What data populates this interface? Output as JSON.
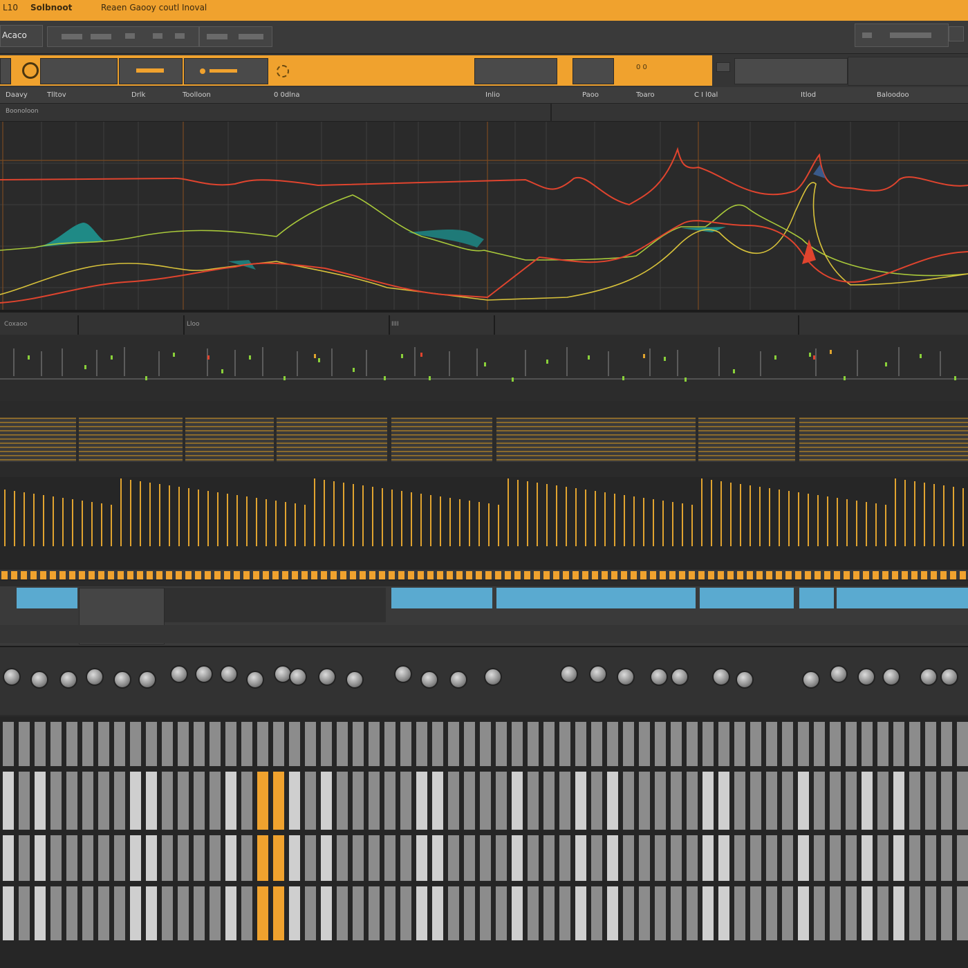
{
  "titlebar": {
    "left_label": "L10",
    "app_name": "Solbnoot",
    "doc_title": "Reaen Gaooy coutl Inoval"
  },
  "toolbar": {
    "brand": "Acaco"
  },
  "transport": {
    "readout": "0  0"
  },
  "header": {
    "columns": [
      "Daavy",
      "Tlltov",
      "Drlk",
      "Toolloon",
      "0 0dlna",
      "Inlio",
      "Paoo",
      "Toaro",
      "C I  l0al",
      "Itlod",
      "Baloodoo"
    ]
  },
  "subheader": {
    "label": "Boonoloon"
  },
  "lanes": {
    "labels": [
      "Coxaoo",
      "Lloo",
      "IIII"
    ]
  },
  "colors": {
    "accent": "#f0a22e",
    "panel": "#2b2b2b",
    "curve_red": "#e0442e",
    "curve_yellow": "#d8c23a",
    "curve_green": "#9ad13a",
    "fill_teal": "#1f8a86",
    "clip_blue": "#5aaad0"
  }
}
